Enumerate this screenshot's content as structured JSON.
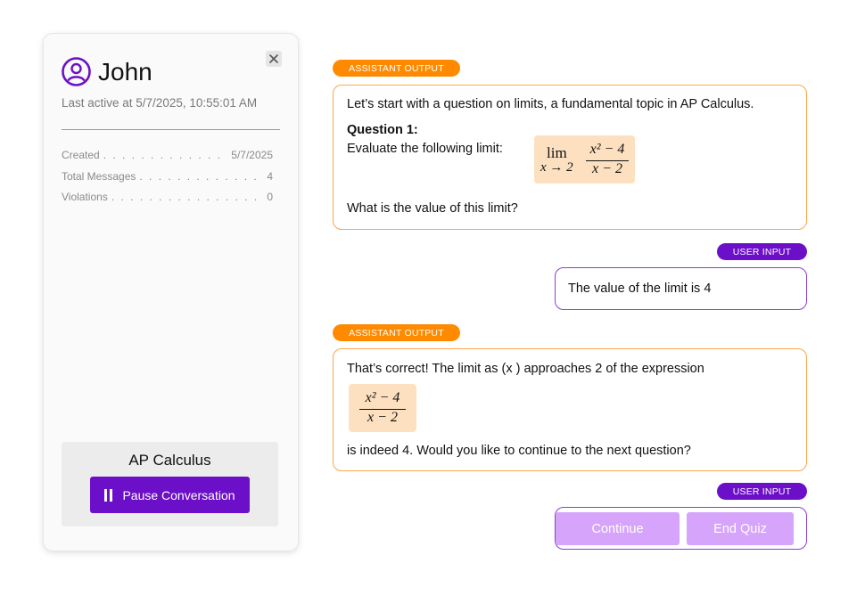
{
  "profile": {
    "name": "John",
    "last_active": "Last active at 5/7/2025, 10:55:01 AM",
    "stats": [
      {
        "label": "Created",
        "value": "5/7/2025"
      },
      {
        "label": "Total Messages",
        "value": "4"
      },
      {
        "label": "Violations",
        "value": "0"
      }
    ],
    "subject": "AP Calculus",
    "pause_label": "Pause Conversation",
    "close_icon": "close-icon",
    "avatar_icon": "user-circle-icon",
    "accent": "#6c0fc8"
  },
  "tags": {
    "assistant": "ASSISTANT OUTPUT",
    "user": "USER INPUT"
  },
  "messages": [
    {
      "intro": "Let’s start with a question on limits, a fundamental topic in AP Calculus.",
      "question_title": "Question 1:",
      "prompt": "Evaluate the following limit:",
      "math": {
        "lim": "lim",
        "sub": "x → 2",
        "num": "x² − 4",
        "den": "x − 2"
      },
      "closing": "What is the value of this limit?"
    },
    {
      "text": "The value of the limit is 4"
    },
    {
      "intro": "That’s correct! The limit as (x ) approaches 2 of the expression",
      "math": {
        "num": "x² − 4",
        "den": "x − 2"
      },
      "closing": "is indeed 4. Would you like to continue to the next question?"
    }
  ],
  "actions": {
    "continue": "Continue",
    "end_quiz": "End Quiz"
  },
  "colors": {
    "assistant_tag": "#ff8a00",
    "assistant_border": "#ffa54a",
    "user_tag": "#6c0fc8",
    "user_border": "#8d3fd6",
    "math_bg": "#fde0c0",
    "action_btn": "#d6a4fb"
  }
}
